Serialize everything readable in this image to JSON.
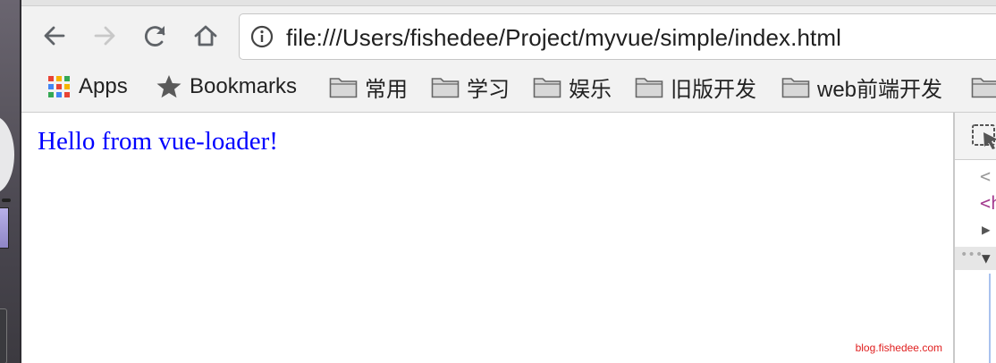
{
  "browser": {
    "nav": {
      "back": "back-arrow",
      "forward": "forward-arrow",
      "reload": "reload",
      "home": "home"
    },
    "address_bar": {
      "icon": "info-circle",
      "url": "file:///Users/fishedee/Project/myvue/simple/index.html"
    },
    "bookmarks": [
      {
        "label": "Apps",
        "icon": "apps-grid"
      },
      {
        "label": "Bookmarks",
        "icon": "star"
      },
      {
        "label": "常用",
        "icon": "folder"
      },
      {
        "label": "学习",
        "icon": "folder"
      },
      {
        "label": "娱乐",
        "icon": "folder"
      },
      {
        "label": "旧版开发",
        "icon": "folder"
      },
      {
        "label": "web前端开发",
        "icon": "folder"
      },
      {
        "label": "",
        "icon": "folder"
      }
    ]
  },
  "page": {
    "message": "Hello from vue-loader!",
    "message_color": "#0000ff"
  },
  "devtools": {
    "lines": [
      "<",
      "<h",
      "▶",
      "▼"
    ]
  },
  "watermark": {
    "text": "blog.fishedee.com",
    "color": "#e02020"
  },
  "colors": {
    "toolbar_bg": "#f2f2f2",
    "apps_dots": [
      "#e84335",
      "#f5b400",
      "#34a853",
      "#4285f4",
      "#e84335",
      "#f5b400",
      "#34a853",
      "#4285f4",
      "#e84335"
    ]
  }
}
